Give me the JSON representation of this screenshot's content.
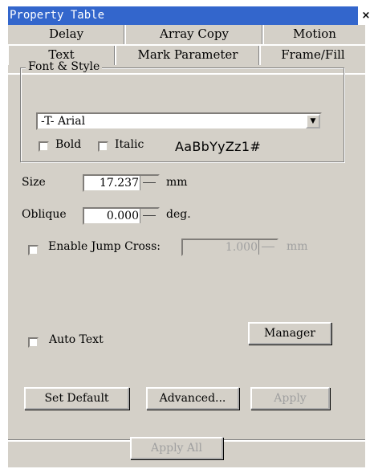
{
  "window": {
    "title": "Property Table",
    "close_label": "×"
  },
  "tabs": {
    "back_row": [
      {
        "label": "Delay"
      },
      {
        "label": "Array Copy"
      },
      {
        "label": "Motion"
      }
    ],
    "front_row": [
      {
        "label": "Text",
        "active": true
      },
      {
        "label": "Mark Parameter"
      },
      {
        "label": "Frame/Fill"
      }
    ]
  },
  "font_style": {
    "group_title": "Font & Style",
    "font_value": "-T-  Arial",
    "bold_label": "Bold",
    "italic_label": "Italic",
    "bold_checked": false,
    "italic_checked": false,
    "preview_text": "AaBbYyZz1#"
  },
  "size": {
    "label": "Size",
    "value": "17.237",
    "unit": "mm"
  },
  "oblique": {
    "label": "Oblique",
    "value": "0.000",
    "unit": "deg."
  },
  "jump_cross": {
    "label": "Enable Jump Cross:",
    "checked": false,
    "value": "1.000",
    "unit": "mm"
  },
  "auto_text": {
    "label": "Auto Text",
    "checked": false
  },
  "buttons": {
    "manager": "Manager",
    "set_default": "Set Default",
    "advanced": "Advanced...",
    "apply": "Apply",
    "apply_all": "Apply All"
  }
}
